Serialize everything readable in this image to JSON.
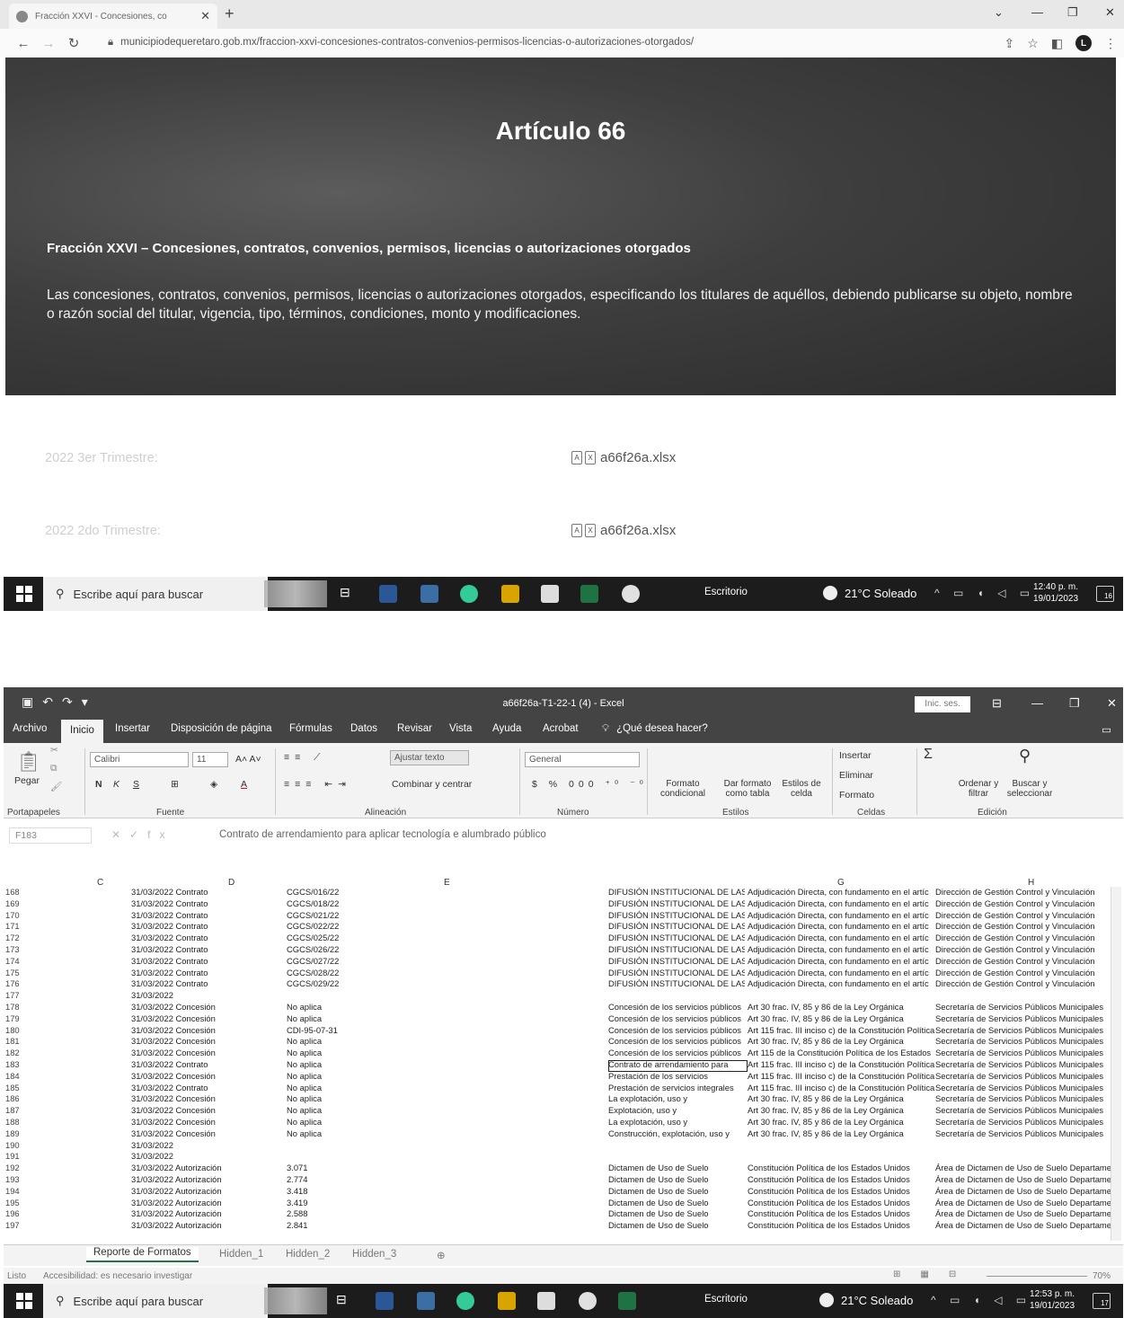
{
  "browser": {
    "tab_title": "Fracción XXVI - Concesiones, co",
    "url": "municipiodequeretaro.gob.mx/fraccion-xxvi-concesiones-contratos-convenios-permisos-licencias-o-autorizaciones-otorgados/",
    "profile_initial": "L"
  },
  "page": {
    "title": "Artículo 66",
    "subtitle": "Fracción XXVI – Concesiones, contratos, convenios, permisos, licencias o autorizaciones otorgados",
    "description": "Las concesiones, contratos, convenios, permisos, licencias o autorizaciones otorgados, especificando los titulares de aquéllos, debiendo publicarse su objeto, nombre o razón social del titular, vigencia, tipo, términos, condiciones, monto y modificaciones.",
    "files": [
      {
        "period": "2022 3er Trimestre:",
        "filename": "a66f26a.xlsx"
      },
      {
        "period": "2022 2do Trimestre:",
        "filename": "a66f26a.xlsx"
      }
    ]
  },
  "taskbar1": {
    "search_placeholder": "Escribe aquí para buscar",
    "desktop_label": "Escritorio",
    "weather": "21°C Soleado",
    "time": "12:40 p. m.",
    "date": "19/01/2023",
    "notifications": "16"
  },
  "excel": {
    "title": "a66f26a-T1-22-1 (4) - Excel",
    "signin": "Inic. ses.",
    "tabs": [
      "Archivo",
      "Inicio",
      "Insertar",
      "Disposición de página",
      "Fórmulas",
      "Datos",
      "Revisar",
      "Vista",
      "Ayuda",
      "Acrobat",
      "¿Qué desea hacer?"
    ],
    "ribbon": {
      "paste": "Pegar",
      "font_name": "Calibri",
      "font_size": "11",
      "wrap_text": "Ajustar texto",
      "merge_center": "Combinar y centrar",
      "number_format": "General",
      "conditional": "Formato condicional",
      "as_table": "Dar formato como tabla",
      "cell_styles": "Estilos de celda",
      "insert": "Insertar",
      "delete": "Eliminar",
      "format": "Formato",
      "sort_filter": "Ordenar y filtrar",
      "find_select": "Buscar y seleccionar",
      "groups": [
        "Portapapeles",
        "Fuente",
        "Alineación",
        "Número",
        "Estilos",
        "Celdas",
        "Edición"
      ]
    },
    "name_box": "F183",
    "formula": "Contrato de arrendamiento para aplicar tecnología e alumbrado público",
    "columns": [
      "C",
      "D",
      "E",
      "G",
      "H"
    ],
    "rows": [
      {
        "n": "168",
        "b": "31/03/2022 Contrato",
        "d": "CGCS/016/22",
        "f": "DIFUSIÓN INSTITUCIONAL DE LAS C",
        "g": "Adjudicación Directa, con fundamento en el artíc",
        "h": "Dirección de Gestión Control y Vinculación"
      },
      {
        "n": "169",
        "b": "31/03/2022 Contrato",
        "d": "CGCS/018/22",
        "f": "DIFUSIÓN INSTITUCIONAL DE LAS C",
        "g": "Adjudicación Directa, con fundamento en el artíc",
        "h": "Dirección de Gestión Control y Vinculación"
      },
      {
        "n": "170",
        "b": "31/03/2022 Contrato",
        "d": "CGCS/021/22",
        "f": "DIFUSIÓN INSTITUCIONAL DE LAS C",
        "g": "Adjudicación Directa, con fundamento en el artíc",
        "h": "Dirección de Gestión Control y Vinculación"
      },
      {
        "n": "171",
        "b": "31/03/2022 Contrato",
        "d": "CGCS/022/22",
        "f": "DIFUSIÓN INSTITUCIONAL DE LAS C",
        "g": "Adjudicación Directa, con fundamento en el artíc",
        "h": "Dirección de Gestión Control y Vinculación"
      },
      {
        "n": "172",
        "b": "31/03/2022 Contrato",
        "d": "CGCS/025/22",
        "f": "DIFUSIÓN INSTITUCIONAL DE LAS C",
        "g": "Adjudicación Directa, con fundamento en el artíc",
        "h": "Dirección de Gestión Control y Vinculación"
      },
      {
        "n": "173",
        "b": "31/03/2022 Contrato",
        "d": "CGCS/026/22",
        "f": "DIFUSIÓN INSTITUCIONAL DE LAS C",
        "g": "Adjudicación Directa, con fundamento en el artíc",
        "h": "Dirección de Gestión Control y Vinculación"
      },
      {
        "n": "174",
        "b": "31/03/2022 Contrato",
        "d": "CGCS/027/22",
        "f": "DIFUSIÓN INSTITUCIONAL DE LAS C",
        "g": "Adjudicación Directa, con fundamento en el artíc",
        "h": "Dirección de Gestión Control y Vinculación"
      },
      {
        "n": "175",
        "b": "31/03/2022 Contrato",
        "d": "CGCS/028/22",
        "f": "DIFUSIÓN INSTITUCIONAL DE LAS C",
        "g": "Adjudicación Directa, con fundamento en el artíc",
        "h": "Dirección de Gestión Control y Vinculación"
      },
      {
        "n": "176",
        "b": "31/03/2022 Contrato",
        "d": "CGCS/029/22",
        "f": "DIFUSIÓN INSTITUCIONAL DE LAS C",
        "g": "Adjudicación Directa, con fundamento en el artíc",
        "h": "Dirección de Gestión Control y Vinculación"
      },
      {
        "n": "177",
        "b": "31/03/2022",
        "d": "",
        "f": "",
        "g": "",
        "h": ""
      },
      {
        "n": "178",
        "b": "31/03/2022 Concesión",
        "d": "No aplica",
        "f": "Concesión de los servicios públicos",
        "g": "Art 30 frac. IV, 85 y 86 de la Ley Orgánica",
        "h": "Secretaría de Servicios Públicos Municipales"
      },
      {
        "n": "179",
        "b": "31/03/2022 Concesión",
        "d": "No aplica",
        "f": "Concesión de los servicios públicos",
        "g": "Art 30 frac. IV, 85 y 86 de la Ley Orgánica",
        "h": "Secretaría de Servicios Públicos Municipales"
      },
      {
        "n": "180",
        "b": "31/03/2022 Concesión",
        "d": "CDI-95-07-31",
        "f": "Concesión de los servicios públicos",
        "g": "Art 115 frac. III inciso c) de la Constitución Política",
        "h": "Secretaría de Servicios Públicos Municipales"
      },
      {
        "n": "181",
        "b": "31/03/2022 Concesión",
        "d": "No aplica",
        "f": "Concesión de los servicios públicos",
        "g": "Art 30 frac. IV, 85 y 86 de la Ley Orgánica",
        "h": "Secretaría de Servicios Públicos Municipales"
      },
      {
        "n": "182",
        "b": "31/03/2022 Concesión",
        "d": "No aplica",
        "f": "Concesión de los servicios públicos",
        "g": "Art 115 de la Constitución Política de los Estados",
        "h": "Secretaría de Servicios Públicos Municipales"
      },
      {
        "n": "183",
        "b": "31/03/2022 Contrato",
        "d": "No aplica",
        "f": "Contrato de arrendamiento para",
        "g": "Art 115 frac. III inciso c) de la Constitución Política",
        "h": "Secretaría de Servicios Públicos Municipales"
      },
      {
        "n": "184",
        "b": "31/03/2022 Concesión",
        "d": "No aplica",
        "f": "Prestación de los servicios",
        "g": "Art 115 frac. III inciso c) de la Constitución Política",
        "h": "Secretaría de Servicios Públicos Municipales"
      },
      {
        "n": "185",
        "b": "31/03/2022 Contrato",
        "d": "No aplica",
        "f": "Prestación de servicios integrales",
        "g": "Art 115 frac. III inciso c) de la Constitución Política",
        "h": "Secretaría de Servicios Públicos Municipales"
      },
      {
        "n": "186",
        "b": "31/03/2022 Concesión",
        "d": "No aplica",
        "f": "La explotación, uso y",
        "g": "Art 30 frac. IV, 85 y 86 de la Ley Orgánica",
        "h": "Secretaría de Servicios Públicos Municipales"
      },
      {
        "n": "187",
        "b": "31/03/2022 Concesión",
        "d": "No aplica",
        "f": "Explotación, uso y",
        "g": "Art 30 frac. IV, 85 y 86 de la Ley Orgánica",
        "h": "Secretaría de Servicios Públicos Municipales"
      },
      {
        "n": "188",
        "b": "31/03/2022 Concesión",
        "d": "No aplica",
        "f": "La explotación, uso y",
        "g": "Art 30 frac. IV, 85 y 86 de la Ley Orgánica",
        "h": "Secretaría de Servicios Públicos Municipales"
      },
      {
        "n": "189",
        "b": "31/03/2022 Concesión",
        "d": "No aplica",
        "f": "Construcción, explotación, uso y",
        "g": "Art 30 frac. IV, 85 y 86 de la Ley Orgánica",
        "h": "Secretaría de Servicios Públicos Municipales"
      },
      {
        "n": "190",
        "b": "31/03/2022",
        "d": "",
        "f": "",
        "g": "",
        "h": ""
      },
      {
        "n": "191",
        "b": "31/03/2022",
        "d": "",
        "f": "",
        "g": "",
        "h": ""
      },
      {
        "n": "192",
        "b": "31/03/2022 Autorización",
        "d": "3.071",
        "f": "Dictamen de Uso de Suelo",
        "g": "Constitución Política de los Estados Unidos",
        "h": "Área de Dictamen de Uso de Suelo Departame"
      },
      {
        "n": "193",
        "b": "31/03/2022 Autorización",
        "d": "2.774",
        "f": "Dictamen de Uso de Suelo",
        "g": "Constitución Política de los Estados Unidos",
        "h": "Área de Dictamen de Uso de Suelo Departame"
      },
      {
        "n": "194",
        "b": "31/03/2022 Autorización",
        "d": "3.418",
        "f": "Dictamen de Uso de Suelo",
        "g": "Constitución Política de los Estados Unidos",
        "h": "Área de Dictamen de Uso de Suelo Departame"
      },
      {
        "n": "195",
        "b": "31/03/2022 Autorización",
        "d": "3.419",
        "f": "Dictamen de Uso de Suelo",
        "g": "Constitución Política de los Estados Unidos",
        "h": "Área de Dictamen de Uso de Suelo Departame"
      },
      {
        "n": "196",
        "b": "31/03/2022 Autorización",
        "d": "2.588",
        "f": "Dictamen de Uso de Suelo",
        "g": "Constitución Política de los Estados Unidos",
        "h": "Área de Dictamen de Uso de Suelo Departame"
      },
      {
        "n": "197",
        "b": "31/03/2022 Autorización",
        "d": "2.841",
        "f": "Dictamen de Uso de Suelo",
        "g": "Constitución Política de los Estados Unidos",
        "h": "Área de Dictamen de Uso de Suelo Departame"
      }
    ],
    "sheets": [
      "Reporte de Formatos",
      "Hidden_1",
      "Hidden_2",
      "Hidden_3"
    ],
    "status_ready": "Listo",
    "status_accessibility": "Accesibilidad: es necesario investigar",
    "zoom": "70%"
  },
  "taskbar2": {
    "search_placeholder": "Escribe aquí para buscar",
    "desktop_label": "Escritorio",
    "weather": "21°C Soleado",
    "time": "12:53 p. m.",
    "date": "19/01/2023",
    "notifications": "17"
  }
}
